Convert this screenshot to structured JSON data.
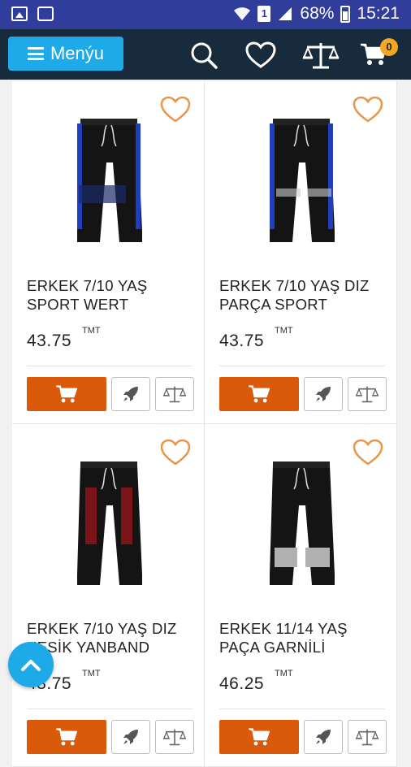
{
  "status_bar": {
    "battery": "68%",
    "time": "15:21",
    "sim": "1"
  },
  "topbar": {
    "menu_label": "Menýu",
    "cart_count": "0",
    "icons": [
      "search-icon",
      "heart-icon",
      "scale-icon",
      "cart-icon"
    ]
  },
  "products": [
    {
      "name": "ERKEK 7/10 YAŞ SPORT WERT",
      "price": "43.75",
      "currency": "TMT",
      "stripe": "#1f3fbf",
      "style": "knee"
    },
    {
      "name": "ERKEK 7/10 YAŞ DIZ PARÇA SPORT",
      "price": "43.75",
      "currency": "TMT",
      "stripe": "#1f3fbf",
      "style": "sport"
    },
    {
      "name": "ERKEK 7/10 YAŞ DIZ KESİK YANBAND",
      "price": "43.75",
      "currency": "TMT",
      "stripe": "#7a1418",
      "style": "band"
    },
    {
      "name": "ERKEK 11/14 YAŞ PAÇA GARNİLİ",
      "price": "46.25",
      "currency": "TMT",
      "stripe": "#b0b0b0",
      "style": "grey"
    }
  ],
  "colors": {
    "statusbar": "#313d9b",
    "topbar": "#182b3c",
    "accent": "#1ea9e8",
    "cart_button": "#d95a0b",
    "heart": "#e8964a",
    "badge": "#f5a623"
  }
}
